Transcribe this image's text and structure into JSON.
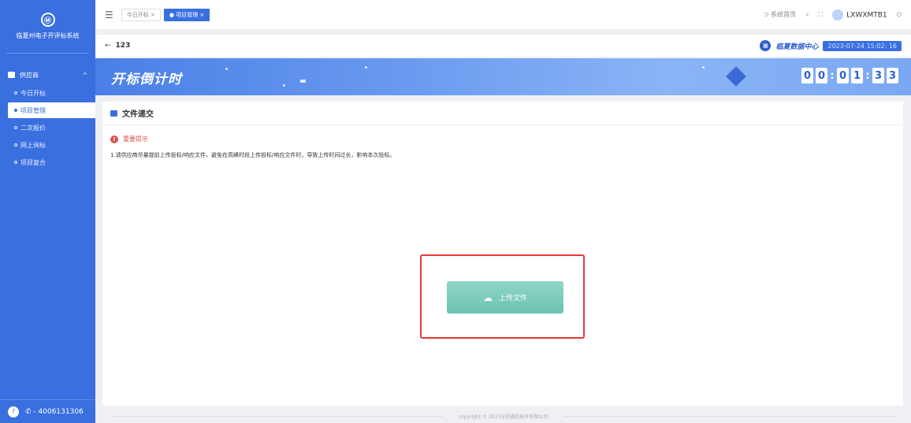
{
  "sidebar": {
    "logo_char": "Ⓜ",
    "system_name": "临夏州电子开评标系统",
    "group_label": "供应商",
    "group_chevron": "^",
    "items": [
      {
        "label": "今日开标"
      },
      {
        "label": "项目管理"
      },
      {
        "label": "二次报价"
      },
      {
        "label": "网上询标"
      },
      {
        "label": "项目复合"
      }
    ],
    "phone": "- 4006131306"
  },
  "topbar": {
    "tabs": [
      {
        "label": "今日开标 ×"
      },
      {
        "label": "● 项目管理 ×"
      }
    ],
    "home_link": "系统首页",
    "username": "LXWXMTB1"
  },
  "subheader": {
    "back_label": "←",
    "title": "123",
    "brand": "临夏数据中心",
    "datetime": "2023-07-24  15:02: 16"
  },
  "banner": {
    "title": "开标倒计时",
    "countdown": [
      "0",
      "0",
      ":",
      "0",
      "1",
      ":",
      "3",
      "3"
    ]
  },
  "main": {
    "section_title": "文件递交",
    "notice_title": "重要提示",
    "notice_text": "1.请供应商尽量提前上传投标/响应文件，避免在高峰时段上传投标/响应文件时，导致上传时间过长，影响本次投标。",
    "upload_label": "上传文件"
  },
  "footer": {
    "copyright": "copyright © 2023全程通信技术有限公司"
  },
  "colors": {
    "sidebar": "#3a6fe0",
    "upload_button": "#6bc4b1",
    "highlight": "#e53935"
  }
}
